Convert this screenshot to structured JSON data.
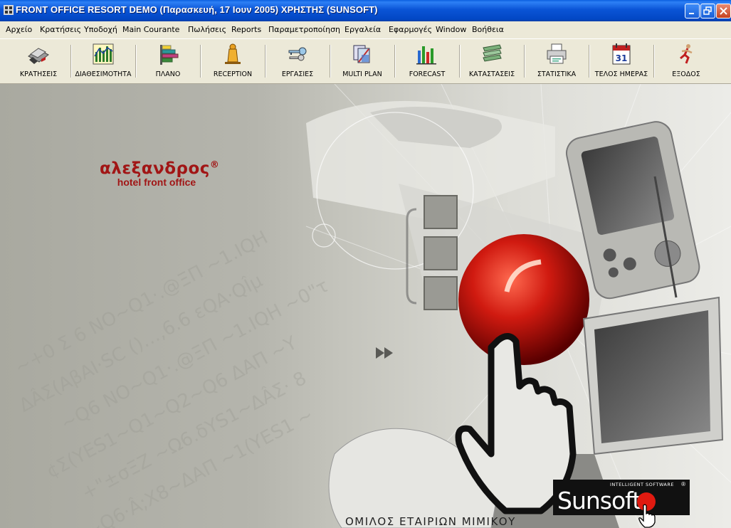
{
  "window": {
    "title": "FRONT OFFICE    RESORT DEMO (Παρασκευή, 17 Ιουν 2005)    ΧΡΗΣΤΗΣ (SUNSOFT)"
  },
  "menu": [
    "Αρχείο",
    "Κρατήσεις",
    "Υποδοχή",
    "Main Courante",
    "Πωλήσεις",
    "Reports",
    "Παραμετροποίηση",
    "Εργαλεία",
    "Εφαρμογές",
    "Window",
    "Βοήθεια"
  ],
  "toolbar": [
    {
      "label": "ΚΡΑΤΗΣΕΙΣ",
      "icon": "reservations-icon"
    },
    {
      "label": "ΔΙΑΘΕΣΙΜΟΤΗΤΑ",
      "icon": "availability-chart-icon"
    },
    {
      "label": "ΠΛΑΝΟ",
      "icon": "plan-bars-icon"
    },
    {
      "label": "RECEPTION",
      "icon": "reception-bell-icon"
    },
    {
      "label": "ΕΡΓΑΣΙΕΣ",
      "icon": "keys-icon"
    },
    {
      "label": "MULTI PLAN",
      "icon": "multi-plan-icon"
    },
    {
      "label": "FORECAST",
      "icon": "forecast-chart-icon"
    },
    {
      "label": "ΚΑΤΑΣΤΑΣΕΙΣ",
      "icon": "reports-stack-icon"
    },
    {
      "label": "ΣΤΑΤΙΣΤΙΚΑ",
      "icon": "statistics-printer-icon"
    },
    {
      "label": "ΤΕΛΟΣ ΗΜΕΡΑΣ",
      "icon": "calendar-icon"
    },
    {
      "label": "ΕΞΟΔΟΣ",
      "icon": "exit-runner-icon"
    }
  ],
  "calendar_day": "31",
  "splash": {
    "brand_name": "αλεξανδρος",
    "brand_mark": "®",
    "brand_subtitle": "hotel front office",
    "group_name": "ΟΜΙΛΟΣ ΕΤΑΙΡΙΩΝ ΜΙΜΙΚΟΥ",
    "sunsoft_tagline": "INTELLIGENT SOFTWARE",
    "sunsoft_logo": "Sunsoft",
    "sunsoft_mark": "®"
  },
  "colors": {
    "titlebar": "#0a54d6",
    "brand_red": "#a11515",
    "face": "#ece9d8"
  }
}
